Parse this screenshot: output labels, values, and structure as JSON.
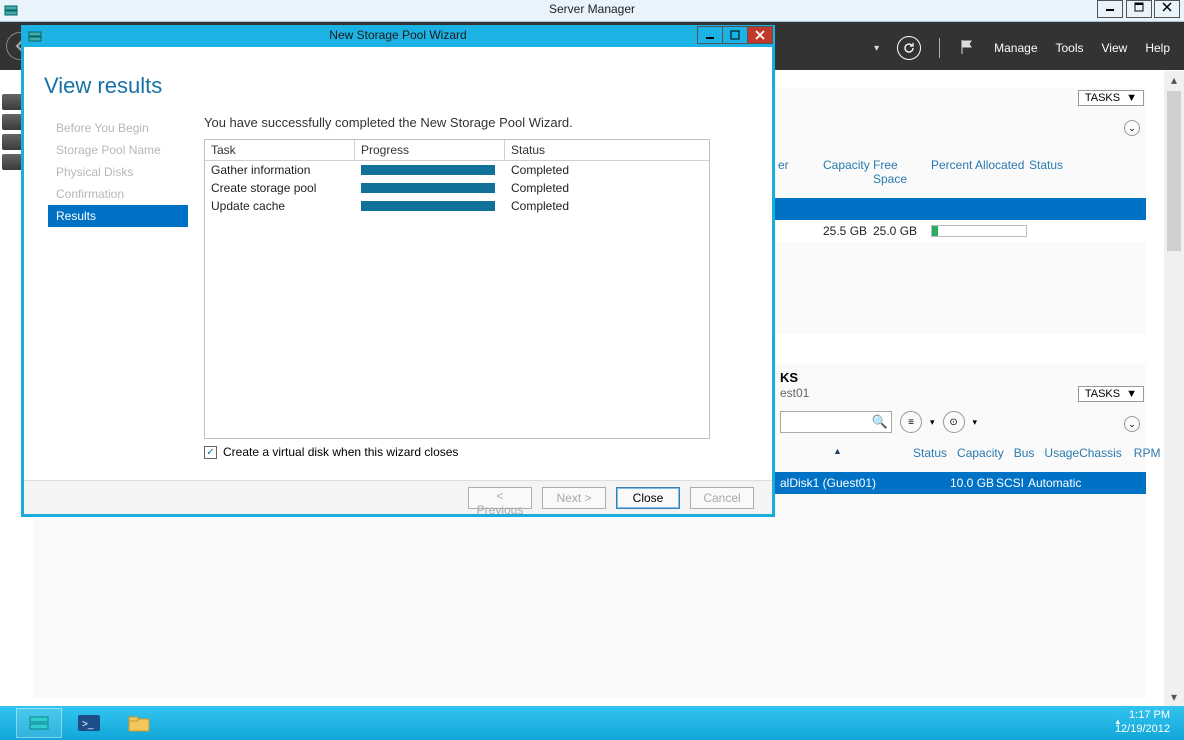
{
  "outer_window": {
    "title": "Server Manager",
    "buttons": {
      "minimize": "_",
      "maximize": "❐",
      "close": "X"
    }
  },
  "sm_toolbar": {
    "refresh_icon": "↻",
    "menu": {
      "manage": "Manage",
      "tools": "Tools",
      "view": "View",
      "help": "Help"
    },
    "back_icon": "←"
  },
  "panel_top": {
    "tasks_label": "TASKS",
    "headers": {
      "capacity": "Capacity",
      "free_space": "Free Space",
      "percent_allocated": "Percent Allocated",
      "status": "Status",
      "server_partial": "er"
    },
    "row": {
      "capacity": "25.5 GB",
      "free": "25.0 GB"
    }
  },
  "panel_bot": {
    "heading_partial": "KS",
    "subhead_partial": "est01",
    "tasks_label": "TASKS",
    "columns": {
      "status": "Status",
      "capacity": "Capacity",
      "bus": "Bus",
      "usage": "Usage",
      "chassis": "Chassis",
      "rpm": "RPM"
    },
    "row": {
      "name": "alDisk1 (Guest01)",
      "capacity": "10.0 GB",
      "bus": "SCSI",
      "usage": "Automatic"
    }
  },
  "wizard": {
    "title": "New Storage Pool Wizard",
    "buttons": {
      "minimize": "_",
      "maximize": "□",
      "close": "X"
    },
    "heading": "View results",
    "steps": [
      "Before You Begin",
      "Storage Pool Name",
      "Physical Disks",
      "Confirmation",
      "Results"
    ],
    "active_step_index": 4,
    "message": "You have successfully completed the New Storage Pool Wizard.",
    "table": {
      "headers": {
        "task": "Task",
        "progress": "Progress",
        "status": "Status"
      },
      "rows": [
        {
          "task": "Gather information",
          "status": "Completed"
        },
        {
          "task": "Create storage pool",
          "status": "Completed"
        },
        {
          "task": "Update cache",
          "status": "Completed"
        }
      ]
    },
    "checkbox_label": "Create a virtual disk when this wizard closes",
    "checkbox_checked": true,
    "footer": {
      "previous": "< Previous",
      "next": "Next >",
      "close": "Close",
      "cancel": "Cancel"
    }
  },
  "taskbar": {
    "time": "1:17 PM",
    "date": "12/19/2012"
  }
}
